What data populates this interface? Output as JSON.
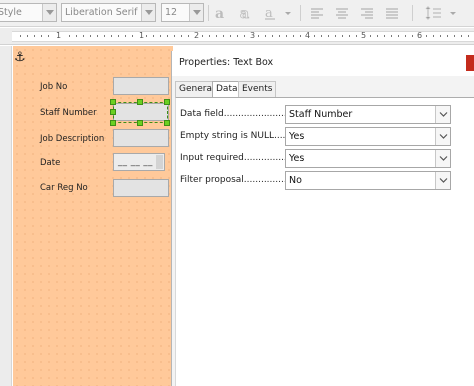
{
  "toolbar": {
    "style_combo": "Style",
    "font_name": "Liberation Serif",
    "font_size": "12",
    "icons": [
      "style-dropdown-icon",
      "text-shadow-icon",
      "text-outline-icon",
      "font-color-icon",
      "align-left-icon",
      "align-center-icon",
      "align-right-icon",
      "justify-icon",
      "line-spacing-icon"
    ]
  },
  "ruler": {
    "numbers": [
      "1",
      "1",
      "2",
      "3",
      "4",
      "5",
      "6"
    ]
  },
  "form": {
    "labels": [
      "Job No",
      "Staff Number",
      "Job Description",
      "Date",
      "Car Reg No"
    ],
    "date_mask": "__ __ __"
  },
  "dialog": {
    "title": "Properties: Text Box",
    "tabs": [
      "General",
      "Data",
      "Events"
    ],
    "active_tab": "Data",
    "rows": [
      {
        "label": "Data field.........................",
        "value": "Staff Number"
      },
      {
        "label": "Empty string is NULL......",
        "value": "Yes"
      },
      {
        "label": "Input required...............",
        "value": "Yes"
      },
      {
        "label": "Filter proposal.................",
        "value": "No"
      }
    ]
  },
  "colors": {
    "form_background": "#ffc99a",
    "selection_handles": "#6bd021",
    "close_button": "#c42b1c"
  }
}
